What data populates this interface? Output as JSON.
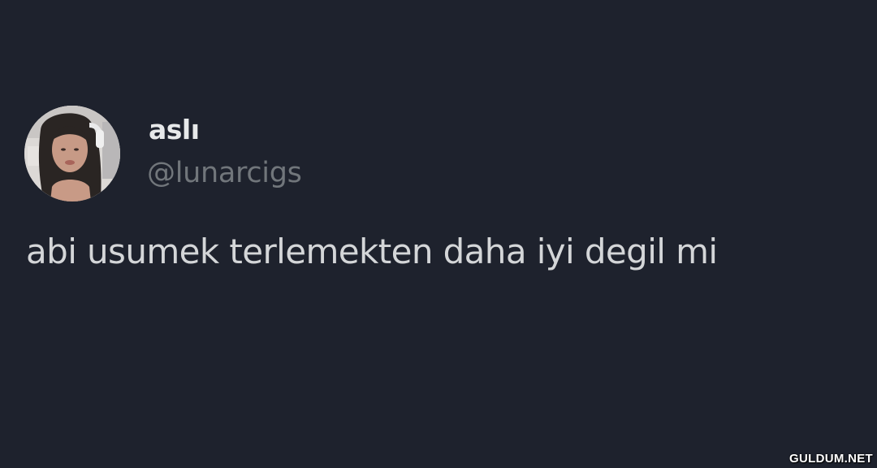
{
  "tweet": {
    "display_name": "aslı",
    "handle": "@lunarcigs",
    "text": "abi usumek terlemekten daha iyi degil mi",
    "avatar_icon": "profile-photo-avatar"
  },
  "watermark": {
    "text": "GULDUM.NET"
  },
  "colors": {
    "background": "#1e222d",
    "display_name": "#e7e9ea",
    "handle": "#71767b",
    "tweet_text": "#d4d6d8"
  }
}
